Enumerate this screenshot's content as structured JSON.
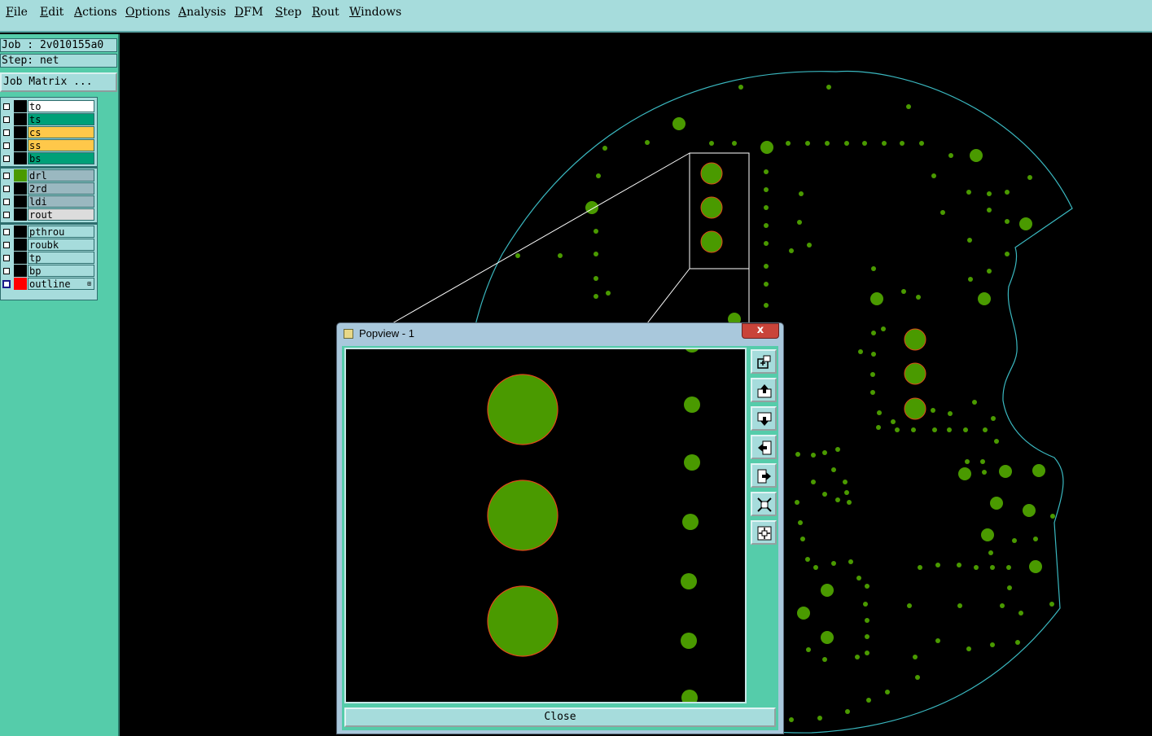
{
  "menu": [
    "File",
    "Edit",
    "Actions",
    "Options",
    "Analysis",
    "DFM",
    "Step",
    "Rout",
    "Windows"
  ],
  "job": {
    "job_label": "Job : 2v010155a0",
    "step_label": "Step: net",
    "matrix_button": "Job Matrix ..."
  },
  "layers": {
    "group1": [
      {
        "name": "to",
        "color": "#ffffff"
      },
      {
        "name": "ts",
        "color": "#00a078"
      },
      {
        "name": "cs",
        "color": "#ffc84a"
      },
      {
        "name": "ss",
        "color": "#ffc84a"
      },
      {
        "name": "bs",
        "color": "#00a078"
      }
    ],
    "group2": [
      {
        "name": "drl",
        "color": "#9ab8c0",
        "swatch": "#4a9a00"
      },
      {
        "name": "2rd",
        "color": "#9ab8c0"
      },
      {
        "name": "ldi",
        "color": "#9ab8c0"
      },
      {
        "name": "rout",
        "color": "#dcdcdc"
      }
    ],
    "group3": [
      {
        "name": "pthrou",
        "color": "#a6dcdc"
      },
      {
        "name": "roubk",
        "color": "#a6dcdc"
      },
      {
        "name": "tp",
        "color": "#a6dcdc"
      },
      {
        "name": "bp",
        "color": "#a6dcdc"
      },
      {
        "name": "outline",
        "color": "#a6dcdc",
        "swatch": "#ff0000",
        "checked": true,
        "expand": "⊞"
      }
    ]
  },
  "popview": {
    "title": "Popview - 1",
    "close_x": "x",
    "close_button": "Close"
  },
  "colors": {
    "menubar_bg": "#a6dcdc",
    "panel_bg": "#55ccaa",
    "pad_fill": "#4a9a00",
    "pad_outline": "#e04a1a",
    "board_outline": "#3ab8c0"
  }
}
